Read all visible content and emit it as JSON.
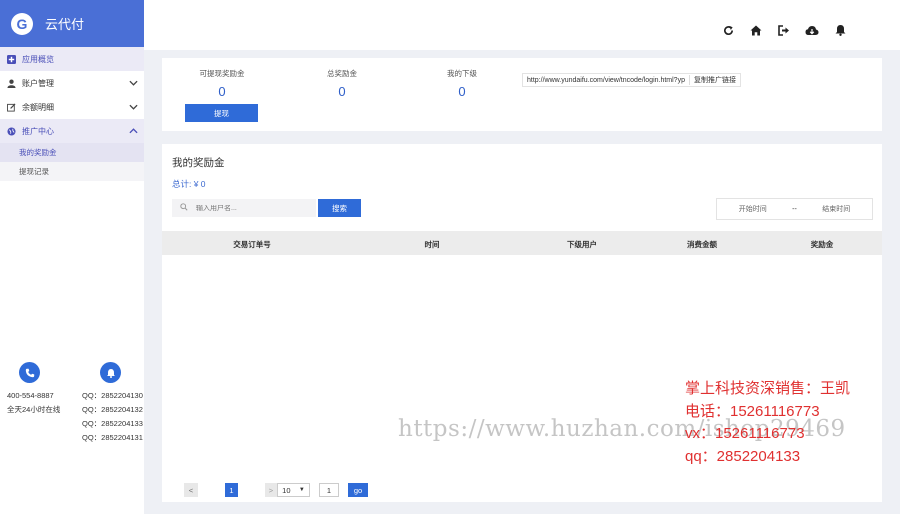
{
  "brand": {
    "logo": "G",
    "name": "云代付"
  },
  "sidebar": {
    "items": [
      {
        "label": "应用概览",
        "icon": "plus-square-icon"
      },
      {
        "label": "账户管理",
        "icon": "user-icon"
      },
      {
        "label": "余额明细",
        "icon": "edit-icon"
      },
      {
        "label": "推广中心",
        "icon": "globe-icon"
      }
    ],
    "subitems": [
      {
        "label": "我的奖励金"
      },
      {
        "label": "提现记录"
      }
    ]
  },
  "contact": {
    "phone": "400-554-8887",
    "hours": "全天24小时在线",
    "qq": [
      "QQ：2852204130",
      "QQ：2852204132",
      "QQ：2852204133",
      "QQ：2852204131"
    ]
  },
  "topbar": {
    "icons": [
      "refresh-icon",
      "home-icon",
      "logout-icon",
      "cloud-download-icon",
      "bell-icon"
    ]
  },
  "stats": {
    "withdrawable_label": "可提现奖励金",
    "withdrawable_value": "0",
    "total_label": "总奖励金",
    "total_value": "0",
    "referrals_label": "我的下级",
    "referrals_value": "0",
    "withdraw_button": "提现",
    "promo_url": "http://www.yundaifu.com/view/tncode/login.html?yp",
    "copy_label": "复制推广链接"
  },
  "main": {
    "title": "我的奖励金",
    "total_text": "总计: ¥ 0",
    "search_placeholder": "输入用户名...",
    "search_button": "搜索",
    "date_start": "开始时间",
    "date_sep": "--",
    "date_end": "结束时间",
    "columns": [
      "交易订单号",
      "时间",
      "下级用户",
      "消费金额",
      "奖励金"
    ]
  },
  "pager": {
    "prev": "<",
    "current": "1",
    "next": ">",
    "page_size": "10",
    "page_input": "1",
    "go": "go"
  },
  "watermark": {
    "url": "https://www.huzhan.com/ishop29469",
    "lines": [
      "掌上科技资深销售：王凯",
      "电话：15261116773",
      "vx：15261116773",
      "qq：2852204133"
    ]
  }
}
